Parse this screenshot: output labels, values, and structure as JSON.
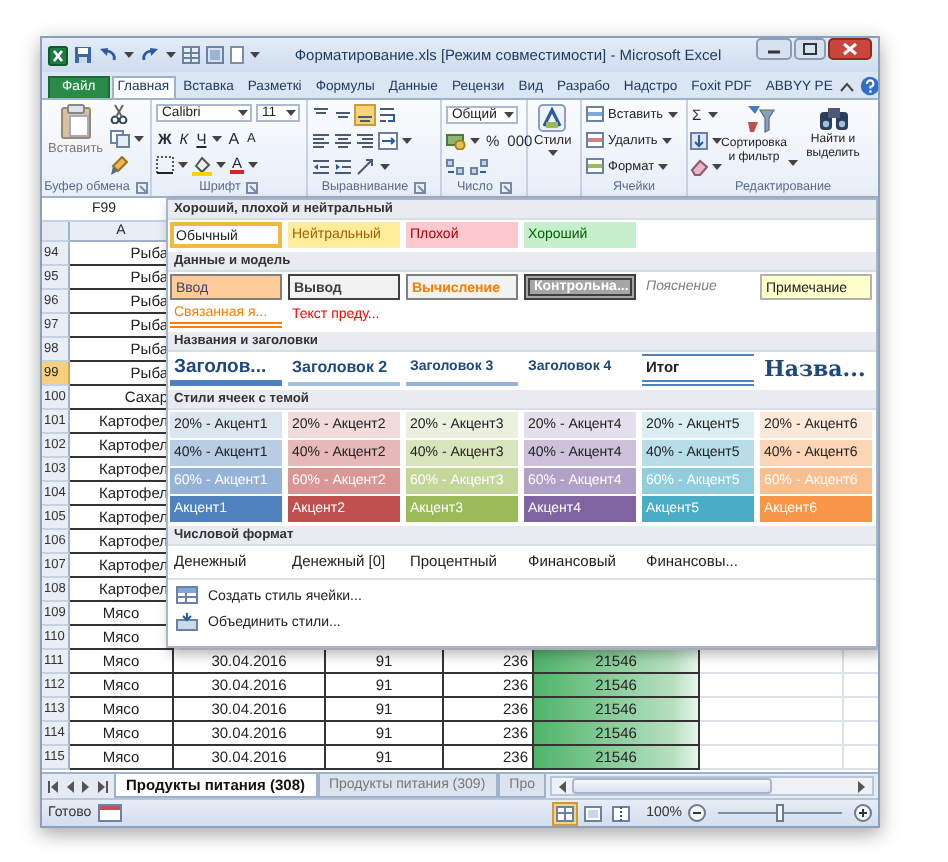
{
  "window": {
    "title": "Форматирование.xls [Режим совместимости] - Microsoft Excel"
  },
  "ribbon_tabs": [
    {
      "label": "Файл",
      "kind": "file",
      "selected": false
    },
    {
      "label": "Главная",
      "kind": "tab",
      "selected": true
    },
    {
      "label": "Вставка",
      "kind": "tab",
      "selected": false
    },
    {
      "label": "Разметкі",
      "kind": "tab",
      "selected": false
    },
    {
      "label": "Формулы",
      "kind": "tab",
      "selected": false
    },
    {
      "label": "Данные",
      "kind": "tab",
      "selected": false
    },
    {
      "label": "Рецензи",
      "kind": "tab",
      "selected": false
    },
    {
      "label": "Вид",
      "kind": "tab",
      "selected": false
    },
    {
      "label": "Разрабо",
      "kind": "tab",
      "selected": false
    },
    {
      "label": "Надстро",
      "kind": "tab",
      "selected": false
    },
    {
      "label": "Foxit PDF",
      "kind": "tab",
      "selected": false
    },
    {
      "label": "ABBYY PE",
      "kind": "tab",
      "selected": false
    }
  ],
  "ribbon_groups": [
    {
      "kind": "clipboard",
      "label": "Буфер обмена",
      "paste": "Вставить"
    },
    {
      "kind": "font",
      "label": "Шрифт",
      "font": "Calibri",
      "size": "11",
      "bold": "Ж",
      "italic": "К",
      "underline": "Ч",
      "grow": "A",
      "shrink": "A",
      "font_color": "A"
    },
    {
      "kind": "alignment",
      "label": "Выравнивание"
    },
    {
      "kind": "number",
      "label": "Число",
      "format": "Общий",
      "percent": "%",
      "thousands": "000"
    },
    {
      "kind": "styles",
      "button": "Стили"
    },
    {
      "kind": "cells",
      "label": "Ячейки",
      "insert": "Вставить",
      "delete": "Удалить",
      "format": "Формат"
    },
    {
      "kind": "editing",
      "label": "Редактирование",
      "sum": "Σ",
      "sort": "Сортировка и фильтр",
      "find": "Найти и выделить"
    }
  ],
  "name_box": "F99",
  "sheet": {
    "columns": [
      {
        "label": "A"
      }
    ],
    "rows": [
      {
        "number": "94",
        "selected": false,
        "cells": [
          {
            "text": "Рыба",
            "kind": "right"
          }
        ]
      },
      {
        "number": "95",
        "selected": false,
        "cells": [
          {
            "text": "Рыба",
            "kind": "right"
          }
        ]
      },
      {
        "number": "96",
        "selected": false,
        "cells": [
          {
            "text": "Рыба",
            "kind": "right"
          }
        ]
      },
      {
        "number": "97",
        "selected": false,
        "cells": [
          {
            "text": "Рыба",
            "kind": "right"
          }
        ]
      },
      {
        "number": "98",
        "selected": false,
        "cells": [
          {
            "text": "Рыба",
            "kind": "right"
          }
        ]
      },
      {
        "number": "99",
        "selected": true,
        "cells": [
          {
            "text": "Рыба",
            "kind": "right"
          }
        ]
      },
      {
        "number": "100",
        "selected": false,
        "cells": [
          {
            "text": "Сахар",
            "kind": "right"
          }
        ]
      },
      {
        "number": "101",
        "selected": false,
        "cells": [
          {
            "text": "Картофел",
            "kind": "right"
          }
        ]
      },
      {
        "number": "102",
        "selected": false,
        "cells": [
          {
            "text": "Картофел",
            "kind": "right"
          }
        ]
      },
      {
        "number": "103",
        "selected": false,
        "cells": [
          {
            "text": "Картофел",
            "kind": "right"
          }
        ]
      },
      {
        "number": "104",
        "selected": false,
        "cells": [
          {
            "text": "Картофел",
            "kind": "right"
          }
        ]
      },
      {
        "number": "105",
        "selected": false,
        "cells": [
          {
            "text": "Картофел",
            "kind": "right"
          }
        ]
      },
      {
        "number": "106",
        "selected": false,
        "cells": [
          {
            "text": "Картофел",
            "kind": "right"
          }
        ]
      },
      {
        "number": "107",
        "selected": false,
        "cells": [
          {
            "text": "Картофел",
            "kind": "right"
          }
        ]
      },
      {
        "number": "108",
        "selected": false,
        "cells": [
          {
            "text": "Картофел",
            "kind": "right"
          }
        ]
      },
      {
        "number": "109",
        "selected": false,
        "cells": [
          {
            "text": "Мясо",
            "kind": "center"
          }
        ]
      },
      {
        "number": "110",
        "selected": false,
        "cells": [
          {
            "text": "Мясо",
            "kind": "center"
          }
        ]
      },
      {
        "number": "111",
        "selected": false,
        "cells": [
          {
            "text": "Мясо",
            "kind": "center"
          },
          {
            "text": "30.04.2016",
            "kind": "center"
          },
          {
            "text": "91",
            "kind": "center"
          },
          {
            "text": "236",
            "kind": "right"
          },
          {
            "text": "21546",
            "kind": "databar",
            "level": 1
          }
        ]
      },
      {
        "number": "112",
        "selected": false,
        "cells": [
          {
            "text": "Мясо",
            "kind": "center"
          },
          {
            "text": "30.04.2016",
            "kind": "center"
          },
          {
            "text": "91",
            "kind": "center"
          },
          {
            "text": "236",
            "kind": "right"
          },
          {
            "text": "21546",
            "kind": "databar",
            "level": 1
          }
        ]
      },
      {
        "number": "113",
        "selected": false,
        "cells": [
          {
            "text": "Мясо",
            "kind": "center"
          },
          {
            "text": "30.04.2016",
            "kind": "center"
          },
          {
            "text": "91",
            "kind": "center"
          },
          {
            "text": "236",
            "kind": "right"
          },
          {
            "text": "21546",
            "kind": "databar",
            "level": 1
          }
        ]
      },
      {
        "number": "114",
        "selected": false,
        "cells": [
          {
            "text": "Мясо",
            "kind": "center"
          },
          {
            "text": "30.04.2016",
            "kind": "center"
          },
          {
            "text": "91",
            "kind": "center"
          },
          {
            "text": "236",
            "kind": "right"
          },
          {
            "text": "21546",
            "kind": "databar",
            "level": 1
          }
        ]
      },
      {
        "number": "115",
        "selected": false,
        "cells": [
          {
            "text": "Мясо",
            "kind": "center"
          },
          {
            "text": "30.04.2016",
            "kind": "center"
          },
          {
            "text": "91",
            "kind": "center"
          },
          {
            "text": "236",
            "kind": "right"
          },
          {
            "text": "21546",
            "kind": "databar",
            "level": 1
          }
        ]
      }
    ]
  },
  "style_gallery": {
    "sections": [
      {
        "title": "Хороший, плохой и нейтральный",
        "styles": [
          {
            "text": "Обычный",
            "kind": "normal",
            "selected": true
          },
          {
            "text": "Нейтральный",
            "kind": "neutral",
            "selected": false
          },
          {
            "text": "Плохой",
            "kind": "bad",
            "selected": false
          },
          {
            "text": "Хороший",
            "kind": "good",
            "selected": false
          }
        ]
      },
      {
        "title": "Данные и модель",
        "styles": [
          {
            "text": "Ввод",
            "kind": "input",
            "selected": false
          },
          {
            "text": "Вывод",
            "kind": "output",
            "selected": false
          },
          {
            "text": "Вычисление",
            "kind": "calculation",
            "selected": false
          },
          {
            "text": "Контрольна...",
            "kind": "check",
            "selected": false
          },
          {
            "text": "Пояснение",
            "kind": "explanatory",
            "selected": false
          },
          {
            "text": "Примечание",
            "kind": "note",
            "selected": false
          },
          {
            "text": "Связанная я...",
            "kind": "linked",
            "selected": false
          },
          {
            "text": "Текст преду...",
            "kind": "warning",
            "selected": false
          }
        ]
      },
      {
        "title": "Названия и заголовки",
        "styles": [
          {
            "text": "Заголов...",
            "kind": "heading1",
            "selected": false
          },
          {
            "text": "Заголовок 2",
            "kind": "heading2",
            "selected": false
          },
          {
            "text": "Заголовок 3",
            "kind": "heading3",
            "selected": false
          },
          {
            "text": "Заголовок 4",
            "kind": "heading4",
            "selected": false
          },
          {
            "text": "Итог",
            "kind": "total",
            "selected": false
          },
          {
            "text": "Назва...",
            "kind": "title",
            "selected": false
          }
        ]
      },
      {
        "title": "Стили ячеек с темой",
        "styles": [
          {
            "text": "20% - Акцент1",
            "kind": "tint",
            "color": "#dce6f1",
            "selected": false
          },
          {
            "text": "20% - Акцент2",
            "kind": "tint",
            "color": "#f2dcdb",
            "selected": false
          },
          {
            "text": "20% - Акцент3",
            "kind": "tint",
            "color": "#ebf1de",
            "selected": false
          },
          {
            "text": "20% - Акцент4",
            "kind": "tint",
            "color": "#e4dfec",
            "selected": false
          },
          {
            "text": "20% - Акцент5",
            "kind": "tint",
            "color": "#daeef3",
            "selected": false
          },
          {
            "text": "20% - Акцент6",
            "kind": "tint",
            "color": "#fde9d9",
            "selected": false
          },
          {
            "text": "40% - Акцент1",
            "kind": "tint",
            "color": "#b8cce4",
            "selected": false
          },
          {
            "text": "40% - Акцент2",
            "kind": "tint",
            "color": "#e6b8b7",
            "selected": false
          },
          {
            "text": "40% - Акцент3",
            "kind": "tint",
            "color": "#d8e4bc",
            "selected": false
          },
          {
            "text": "40% - Акцент4",
            "kind": "tint",
            "color": "#ccc0da",
            "selected": false
          },
          {
            "text": "40% - Акцент5",
            "kind": "tint",
            "color": "#b7dee8",
            "selected": false
          },
          {
            "text": "40% - Акцент6",
            "kind": "tint",
            "color": "#fcd5b4",
            "selected": false
          },
          {
            "text": "60% - Акцент1",
            "kind": "shade",
            "color": "#95b3d7",
            "selected": false
          },
          {
            "text": "60% - Акцент2",
            "kind": "shade",
            "color": "#da9694",
            "selected": false
          },
          {
            "text": "60% - Акцент3",
            "kind": "shade",
            "color": "#c4d79b",
            "selected": false
          },
          {
            "text": "60% - Акцент4",
            "kind": "shade",
            "color": "#b1a0c7",
            "selected": false
          },
          {
            "text": "60% - Акцент5",
            "kind": "shade",
            "color": "#92cddc",
            "selected": false
          },
          {
            "text": "60% - Акцент6",
            "kind": "shade",
            "color": "#fabf8f",
            "selected": false
          },
          {
            "text": "Акцент1",
            "kind": "accent",
            "color": "#4f81bd",
            "selected": false
          },
          {
            "text": "Акцент2",
            "kind": "accent",
            "color": "#c0504d",
            "selected": false
          },
          {
            "text": "Акцент3",
            "kind": "accent",
            "color": "#9bbb59",
            "selected": false
          },
          {
            "text": "Акцент4",
            "kind": "accent",
            "color": "#8064a2",
            "selected": false
          },
          {
            "text": "Акцент5",
            "kind": "accent",
            "color": "#4bacc6",
            "selected": false
          },
          {
            "text": "Акцент6",
            "kind": "accent",
            "color": "#f79646",
            "selected": false
          }
        ]
      },
      {
        "title": "Числовой формат",
        "styles": [
          {
            "text": "Денежный",
            "kind": "number",
            "selected": false
          },
          {
            "text": "Денежный [0]",
            "kind": "number",
            "selected": false
          },
          {
            "text": "Процентный",
            "kind": "number",
            "selected": false
          },
          {
            "text": "Финансовый",
            "kind": "number",
            "selected": false
          },
          {
            "text": "Финансовы...",
            "kind": "number",
            "selected": false
          }
        ]
      }
    ],
    "commands": [
      {
        "text": "Создать стиль ячейки..."
      },
      {
        "text": "Объединить стили..."
      }
    ]
  },
  "sheet_tabs": [
    {
      "label": "Продукты питания (308)",
      "selected": true
    },
    {
      "label": "Продукты питания (309)",
      "selected": false
    },
    {
      "label": "Про",
      "selected": false
    }
  ],
  "status_bar": {
    "status": "Готово",
    "view_buttons": [
      {
        "selected": true
      },
      {
        "selected": false
      },
      {
        "selected": false
      }
    ],
    "zoom": "100%",
    "zoom_slider": {
      "level": 0.5
    }
  }
}
